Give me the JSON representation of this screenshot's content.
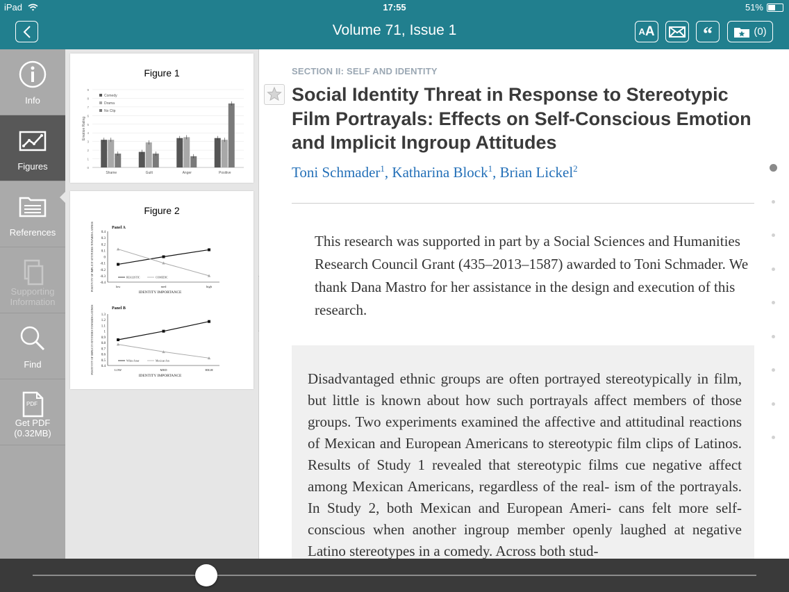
{
  "status": {
    "device": "iPad",
    "time": "17:55",
    "battery": "51%",
    "battery_level": 0.51
  },
  "header": {
    "title": "Volume 71, Issue 1",
    "saved_count": "(0)"
  },
  "sidebar": {
    "items": [
      {
        "label": "Info",
        "icon": "info-icon"
      },
      {
        "label": "Figures",
        "icon": "chart-icon"
      },
      {
        "label": "References",
        "icon": "folder-icon"
      },
      {
        "label": "Supporting Information",
        "icon": "copy-icon"
      },
      {
        "label": "Find",
        "icon": "search-icon"
      },
      {
        "label": "Get PDF",
        "sublabel": "(0.32MB)",
        "icon": "pdf-icon"
      }
    ]
  },
  "figures": [
    {
      "title": "Figure 1",
      "chart_data": {
        "type": "bar",
        "categories": [
          "Shame",
          "Guilt",
          "Anger",
          "Positive"
        ],
        "series": [
          {
            "name": "Comedy",
            "values": [
              3.2,
              1.8,
              3.4,
              3.4
            ],
            "color": "#555555"
          },
          {
            "name": "Drama",
            "values": [
              3.2,
              2.9,
              3.5,
              3.2
            ],
            "color": "#a8a8a8"
          },
          {
            "name": "No Clip",
            "values": [
              1.6,
              1.6,
              1.3,
              7.4
            ],
            "color": "#7a7a7a"
          }
        ],
        "ylabel": "Emotion Rating",
        "ylim": [
          0,
          9
        ],
        "yticks": [
          "0",
          "1",
          "2",
          "3",
          "4",
          "5",
          "6",
          "7",
          "8",
          "9"
        ]
      }
    },
    {
      "title": "Figure 2",
      "panels": [
        {
          "chart_data": {
            "type": "line",
            "title": "Panel A",
            "categories": [
              "low",
              "med",
              "high"
            ],
            "series": [
              {
                "name": "REALISTIC",
                "values": [
                  -0.12,
                  0.0,
                  0.11
                ]
              },
              {
                "name": "COMEDIC",
                "values": [
                  0.12,
                  -0.1,
                  -0.3
                ]
              }
            ],
            "xlabel": "IDENTITY IMPORTANCE",
            "ylabel": "POSITIVITY OF IMPLICIT ATTITUDES TOWARDS LATINOS",
            "ylim": [
              -0.4,
              0.4
            ],
            "yticks": [
              "0.4",
              "0.3",
              "0.2",
              "0.1",
              "0",
              "-0.1",
              "-0.2",
              "-0.3",
              "-0.4"
            ]
          }
        },
        {
          "chart_data": {
            "type": "line",
            "title": "Panel B",
            "categories": [
              "LOW",
              "MED",
              "HIGH"
            ],
            "series": [
              {
                "name": "White Amer",
                "values": [
                  0.85,
                  1.0,
                  1.17
                ]
              },
              {
                "name": "Mexican Am",
                "values": [
                  0.77,
                  0.64,
                  0.53
                ]
              }
            ],
            "xlabel": "IDENTITY IMPORTANCE",
            "ylabel": "POSITIVITY OF IMPLICIT ATTITUDES TOWARDS LATINOS",
            "ylim": [
              0.4,
              1.3
            ],
            "yticks": [
              "1.3",
              "1.2",
              "1.1",
              "1",
              "0.9",
              "0.8",
              "0.7",
              "0.6",
              "0.5",
              "0.4"
            ]
          }
        }
      ]
    }
  ],
  "article": {
    "section": "SECTION II: SELF AND IDENTITY",
    "title": "Social Identity Threat in Response to Stereotypic Film Portrayals: Effects on Self-Conscious Emotion and Implicit Ingroup Attitudes",
    "authors": [
      {
        "name": "Toni Schmader",
        "sup": "1"
      },
      {
        "name": "Katharina Block",
        "sup": "1"
      },
      {
        "name": "Brian Lickel",
        "sup": "2"
      }
    ],
    "author_separator": ", ",
    "funding": "This research was supported in part by a Social Sciences and Humanities Research Council Grant (435–2013–1587) awarded to Toni Schmader. We thank Dana Mastro for her assistance in the design and execution of this research.",
    "abstract": "Disadvantaged ethnic groups are often portrayed stereotypically in film, but little is known about how such portrayals affect members of those groups. Two experiments examined the affective and attitudinal reactions of Mexican and European Americans to stereotypic film clips of Latinos. Results of Study 1 revealed that stereotypic films cue negative affect among Mexican Americans, regardless of the real- ism of the portrayals. In Study 2, both Mexican and European Ameri- cans felt more self-conscious when another ingroup member openly laughed at negative Latino stereotypes in a comedy. Across both stud-"
  },
  "page_position": {
    "current_index": 0,
    "count": 9
  },
  "scrubber": {
    "position": 0.24
  }
}
